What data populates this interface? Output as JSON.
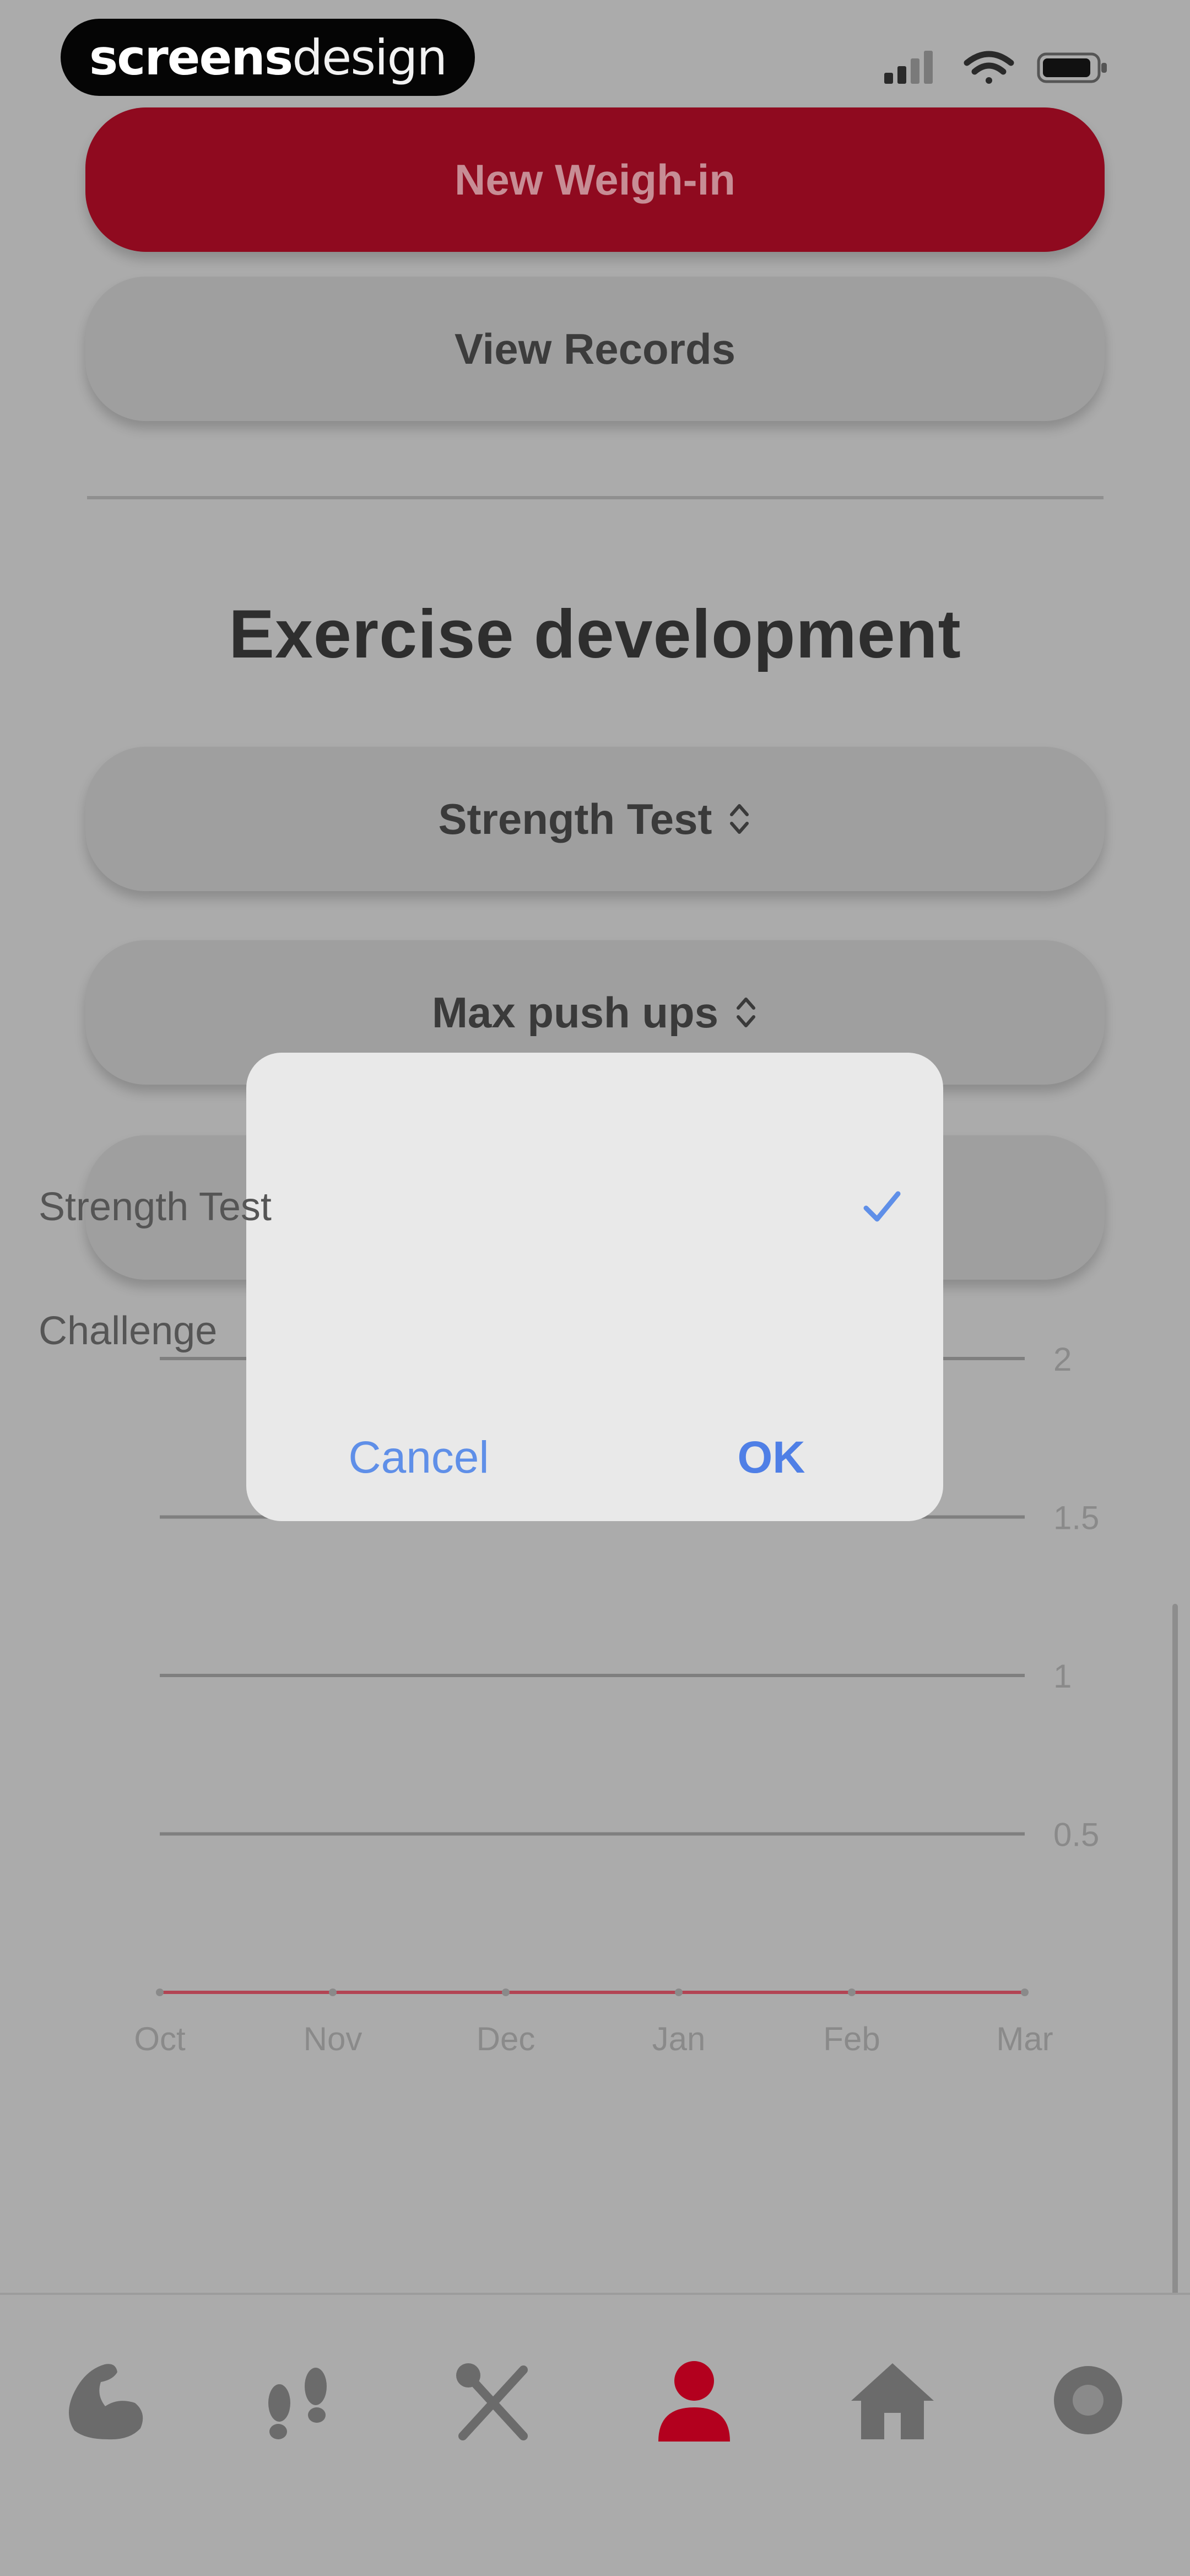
{
  "status": {
    "brand_bold": "screens",
    "brand_light": "design"
  },
  "buttons": {
    "new_weigh_in": "New Weigh-in",
    "view_records": "View Records",
    "test_select": "Strength Test",
    "exercise_select": "Max push ups",
    "third_select": ""
  },
  "section": {
    "title": "Exercise development"
  },
  "dialog": {
    "options": [
      {
        "label": "Strength Test",
        "selected": true
      },
      {
        "label": "Challenge",
        "selected": false
      }
    ],
    "cancel": "Cancel",
    "ok": "OK"
  },
  "chart_data": {
    "type": "line",
    "title": "",
    "xlabel": "",
    "ylabel": "",
    "categories": [
      "Oct",
      "Nov",
      "Dec",
      "Jan",
      "Feb",
      "Mar"
    ],
    "ylim": [
      0,
      2
    ],
    "yticks": [
      2,
      1.5,
      1,
      0.5
    ],
    "y_tick_labels": [
      "2",
      "1.5",
      "1",
      "0.5"
    ],
    "series": [
      {
        "values": [
          0,
          0,
          0,
          0,
          0,
          0
        ]
      }
    ],
    "grid": true,
    "series_color": "#b24454"
  },
  "tabs": [
    {
      "name": "strength-icon",
      "active": false
    },
    {
      "name": "footsteps-icon",
      "active": false
    },
    {
      "name": "nutrition-icon",
      "active": false
    },
    {
      "name": "profile-icon",
      "active": true
    },
    {
      "name": "home-icon",
      "active": false
    },
    {
      "name": "settings-icon",
      "active": false
    }
  ],
  "colors": {
    "accent": "#8f0a1f",
    "active_tab": "#b3001e",
    "link": "#5f8fe8"
  }
}
